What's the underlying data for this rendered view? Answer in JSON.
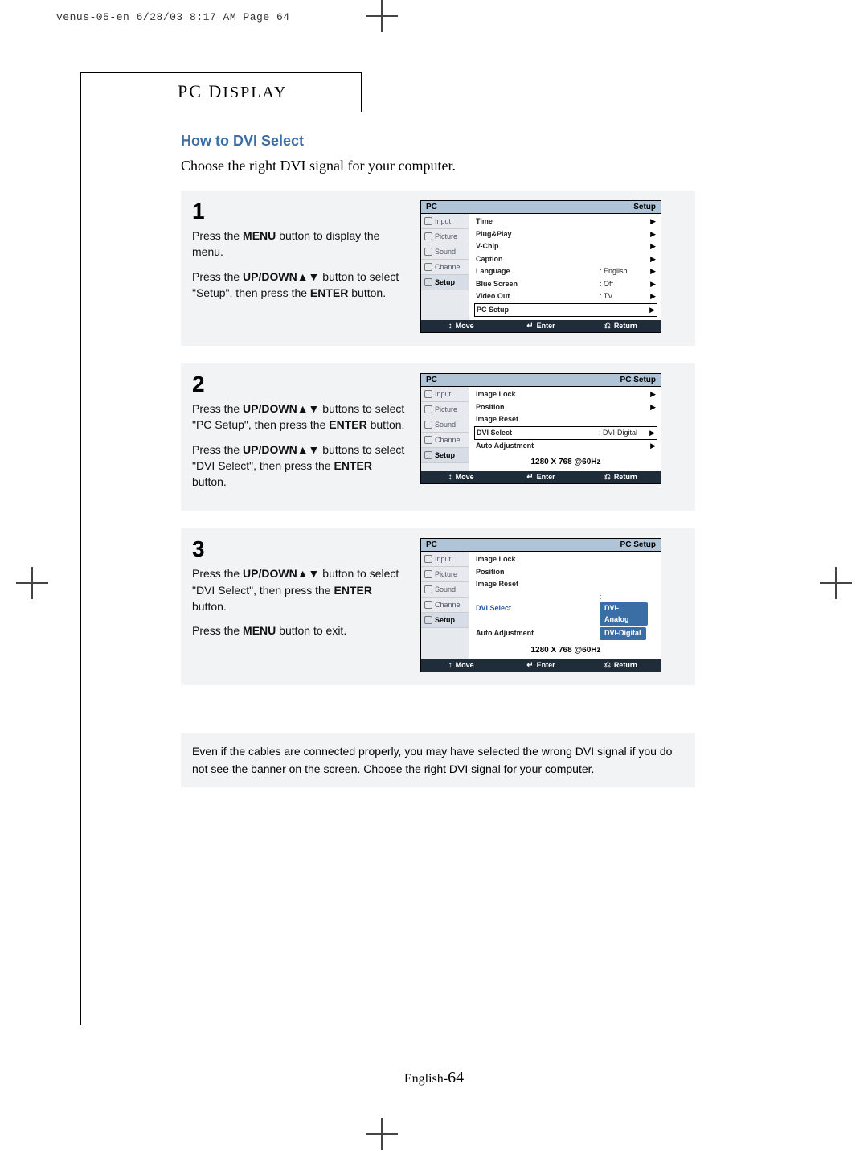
{
  "print_header": "venus-05-en  6/28/03 8:17 AM  Page 64",
  "section_title": {
    "prefix": "PC D",
    "rest": "ISPLAY"
  },
  "heading": "How to DVI Select",
  "intro": "Choose the right DVI signal for your computer.",
  "steps": {
    "s1": {
      "num": "1",
      "p1_a": "Press the ",
      "p1_b": "MENU",
      "p1_c": " button to display the menu.",
      "p2_a": "Press the ",
      "p2_b": "UP/DOWN",
      "p2_c": "▲▼ button to select \"Setup\", then press the ",
      "p2_d": "ENTER",
      "p2_e": "  button."
    },
    "s2": {
      "num": "2",
      "p1_a": "Press the ",
      "p1_b": "UP/DOWN",
      "p1_c": "▲▼ buttons to select \"PC Setup\", then press the ",
      "p1_d": "ENTER",
      "p1_e": "  button.",
      "p2_a": "Press the ",
      "p2_b": "UP/DOWN",
      "p2_c": "▲▼ buttons to select \"DVI Select\", then press the ",
      "p2_d": "ENTER",
      "p2_e": "  button."
    },
    "s3": {
      "num": "3",
      "p1_a": "Press the ",
      "p1_b": "UP/DOWN",
      "p1_c": "▲▼ button to select \"DVI Select\", then press the ",
      "p1_d": "ENTER",
      "p1_e": " button.",
      "p2_a": "Press the ",
      "p2_b": "MENU",
      "p2_c": " button to exit."
    }
  },
  "osd": {
    "tabs": {
      "input": "Input",
      "picture": "Picture",
      "sound": "Sound",
      "channel": "Channel",
      "setup": "Setup"
    },
    "footer": {
      "move": "Move",
      "enter": "Enter",
      "return": "Return"
    },
    "menu1": {
      "head_left": "PC",
      "head_right": "Setup",
      "rows": [
        {
          "l": "Time",
          "v": "",
          "arr": "▶"
        },
        {
          "l": "Plug&Play",
          "v": "",
          "arr": "▶"
        },
        {
          "l": "V-Chip",
          "v": "",
          "arr": "▶"
        },
        {
          "l": "Caption",
          "v": "",
          "arr": "▶"
        },
        {
          "l": "Language",
          "v": ": English",
          "arr": "▶"
        },
        {
          "l": "Blue Screen",
          "v": ": Off",
          "arr": "▶"
        },
        {
          "l": "Video Out",
          "v": ": TV",
          "arr": "▶"
        },
        {
          "l": "PC Setup",
          "v": "",
          "arr": "▶",
          "sel": true
        }
      ]
    },
    "menu2": {
      "head_left": "PC",
      "head_right": "PC Setup",
      "rows": [
        {
          "l": "Image Lock",
          "v": "",
          "arr": "▶"
        },
        {
          "l": "Position",
          "v": "",
          "arr": "▶"
        },
        {
          "l": "Image Reset",
          "v": "",
          "arr": ""
        },
        {
          "l": "DVI Select",
          "v": ": DVI-Digital",
          "arr": "▶",
          "sel": true
        },
        {
          "l": "Auto Adjustment",
          "v": "",
          "arr": "▶"
        }
      ],
      "res": "1280 X 768 @60Hz"
    },
    "menu3": {
      "head_left": "PC",
      "head_right": "PC Setup",
      "rows": [
        {
          "l": "Image Lock",
          "v": "",
          "arr": ""
        },
        {
          "l": "Position",
          "v": "",
          "arr": ""
        },
        {
          "l": "Image Reset",
          "v": "",
          "arr": ""
        }
      ],
      "dvi_label": "DVI Select",
      "dvi_colon": ":",
      "options": [
        "DVI-Analog",
        "DVI-Digital"
      ],
      "auto": "Auto Adjustment",
      "res": "1280 X 768 @60Hz"
    }
  },
  "note": "Even if the cables are connected properly, you may have selected the wrong DVI signal if you do not see the banner on the screen. Choose the right DVI signal for your computer.",
  "footer": {
    "lang": "English-",
    "page": "64"
  }
}
